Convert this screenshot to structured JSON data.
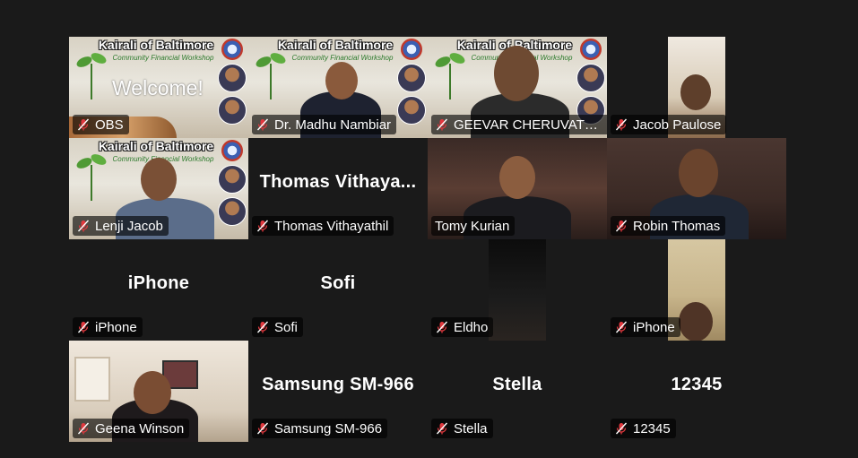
{
  "banner": {
    "title": "Kairali of Baltimore",
    "subtitle": "Community Financial Workshop",
    "welcome": "Welcome!"
  },
  "accent_active": "#2cd96b",
  "muted_icon": "mic-muted-icon",
  "participants": [
    {
      "label": "OBS"
    },
    {
      "label": "Dr. Madhu Nambiar"
    },
    {
      "label": "GEEVAR CHERUVATHO..."
    },
    {
      "label": "Jacob Paulose"
    },
    {
      "label": "Lenji Jacob"
    },
    {
      "label": "Thomas Vithayathil",
      "display_name": "Thomas  Vithaya..."
    },
    {
      "label": "Tomy Kurian",
      "active_speaker": true
    },
    {
      "label": "Robin Thomas"
    },
    {
      "label": "iPhone",
      "display_name": "iPhone"
    },
    {
      "label": "Sofi",
      "display_name": "Sofi"
    },
    {
      "label": "Eldho"
    },
    {
      "label": "iPhone"
    },
    {
      "label": "Geena Winson"
    },
    {
      "label": "Samsung SM-966",
      "display_name": "Samsung SM-966"
    },
    {
      "label": "Stella",
      "display_name": "Stella"
    },
    {
      "label": "12345",
      "display_name": "12345"
    }
  ]
}
